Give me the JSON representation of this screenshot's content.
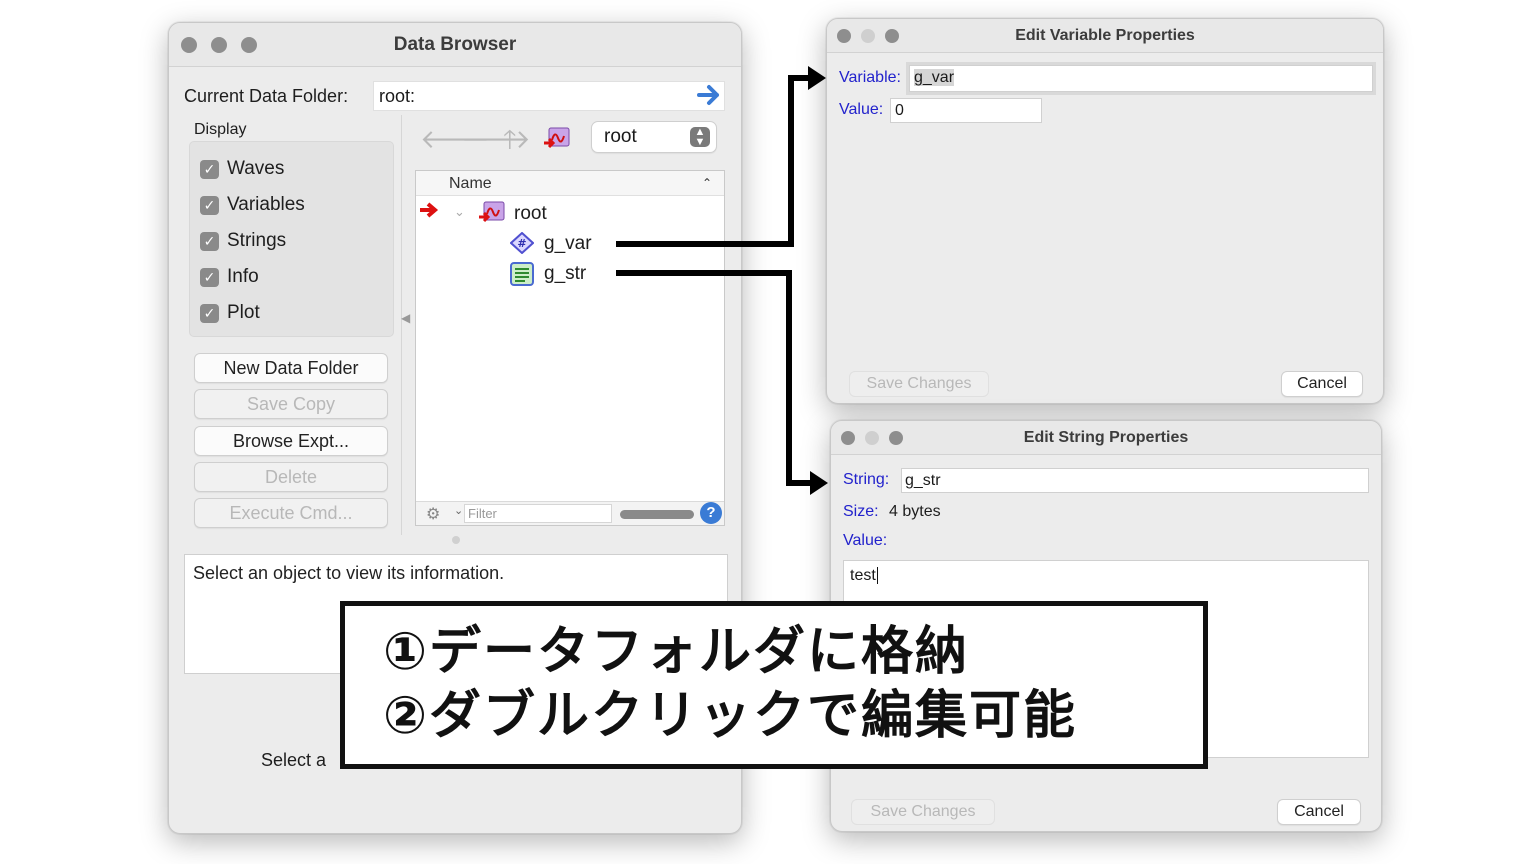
{
  "data_browser": {
    "title": "Data Browser",
    "current_folder_label": "Current Data Folder:",
    "current_folder_value": "root:",
    "display_label": "Display",
    "display_options": [
      "Waves",
      "Variables",
      "Strings",
      "Info",
      "Plot"
    ],
    "buttons": [
      "New Data Folder",
      "Save Copy",
      "Browse Expt...",
      "Delete",
      "Execute Cmd..."
    ],
    "folder_select": "root",
    "tree_header": "Name",
    "tree_items": [
      "root",
      "g_var",
      "g_str"
    ],
    "filter_placeholder": "Filter",
    "info_text": "Select an object to view its information.",
    "footer_text": "Select a"
  },
  "edit_variable": {
    "title": "Edit Variable Properties",
    "variable_label": "Variable:",
    "variable_value": "g_var",
    "value_label": "Value:",
    "value_value": "0",
    "save_label": "Save Changes",
    "cancel_label": "Cancel"
  },
  "edit_string": {
    "title": "Edit String Properties",
    "string_label": "String:",
    "string_value": "g_str",
    "size_label": "Size:",
    "size_value": "4 bytes",
    "value_label": "Value:",
    "value_text": "test",
    "save_label": "Save Changes",
    "cancel_label": "Cancel"
  },
  "callout": {
    "line1": "①データフォルダに格納",
    "line2": "②ダブルクリックで編集可能"
  },
  "colors": {
    "accent_blue": "#2222cc",
    "arrow_blue": "#3a7bd5",
    "marker_red": "#dd1111"
  }
}
